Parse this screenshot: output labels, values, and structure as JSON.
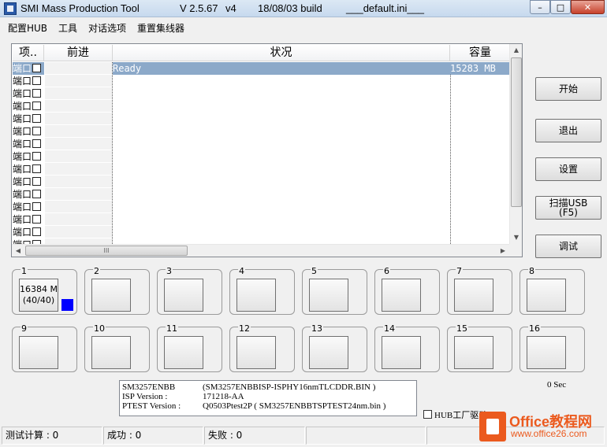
{
  "window": {
    "app_name": "SMI Mass Production Tool",
    "version": "V 2.5.67",
    "variant": "v4",
    "build": "18/08/03 build",
    "ini_file": "___default.ini___",
    "controls": {
      "minimize": "–",
      "maximize": "□",
      "close": "✕"
    }
  },
  "menu": {
    "items": [
      "配置HUB",
      "工具",
      "对话选项",
      "重置集线器"
    ]
  },
  "list": {
    "columns": [
      "项..",
      "前进",
      "状况",
      "容量"
    ],
    "rows": [
      {
        "port": "端口",
        "status": "Ready",
        "capacity": "15283 MB",
        "selected": true
      },
      {
        "port": "端口",
        "status": "",
        "capacity": ""
      },
      {
        "port": "端口",
        "status": "",
        "capacity": ""
      },
      {
        "port": "端口",
        "status": "",
        "capacity": ""
      },
      {
        "port": "端口",
        "status": "",
        "capacity": ""
      },
      {
        "port": "端口",
        "status": "",
        "capacity": ""
      },
      {
        "port": "端口",
        "status": "",
        "capacity": ""
      },
      {
        "port": "端口",
        "status": "",
        "capacity": ""
      },
      {
        "port": "端口",
        "status": "",
        "capacity": ""
      },
      {
        "port": "端口",
        "status": "",
        "capacity": ""
      },
      {
        "port": "端口",
        "status": "",
        "capacity": ""
      },
      {
        "port": "端口",
        "status": "",
        "capacity": ""
      },
      {
        "port": "端口",
        "status": "",
        "capacity": ""
      },
      {
        "port": "端口",
        "status": "",
        "capacity": ""
      },
      {
        "port": "端口",
        "status": "",
        "capacity": ""
      }
    ],
    "hscroll_thumb_glyph": "III"
  },
  "buttons": {
    "start": "开始",
    "exit": "退出",
    "settings": "设置",
    "scan_usb": "扫描USB",
    "scan_usb_key": "(F5)",
    "debug": "调试"
  },
  "ports": [
    {
      "num": "1",
      "line1": "16384 M",
      "line2": "(40/40)",
      "active": true
    },
    {
      "num": "2"
    },
    {
      "num": "3"
    },
    {
      "num": "4"
    },
    {
      "num": "5"
    },
    {
      "num": "6"
    },
    {
      "num": "7"
    },
    {
      "num": "8"
    },
    {
      "num": "9"
    },
    {
      "num": "10"
    },
    {
      "num": "11"
    },
    {
      "num": "12"
    },
    {
      "num": "13"
    },
    {
      "num": "14"
    },
    {
      "num": "15"
    },
    {
      "num": "16"
    }
  ],
  "info": {
    "controller": "SM3257ENBB",
    "controller_file": "(SM3257ENBBISP-ISPHY16nmTLCDDR.BIN )",
    "isp_label": "ISP Version :",
    "isp_value": "171218-AA",
    "ptest_label": "PTEST Version :",
    "ptest_value": "Q0503Ptest2P ( SM3257ENBBTSPTEST24nm.bin )"
  },
  "timer": "0 Sec",
  "hub_checkbox_label": "HUB工厂驱动",
  "statusbar": {
    "test_count": "测试计算 : 0",
    "success": "成功 : 0",
    "fail": "失败 : 0"
  },
  "watermark": {
    "brand": "Office教程网",
    "url": "www.office26.com"
  },
  "colors": {
    "selection": "#8ca9c9",
    "port_indicator": "#0000ff",
    "watermark": "#eb5a1e"
  }
}
